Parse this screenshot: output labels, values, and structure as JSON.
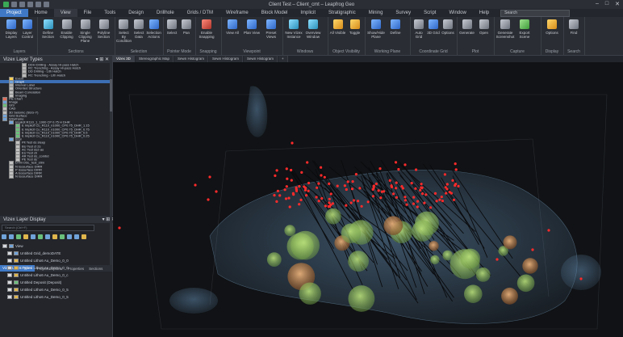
{
  "app": {
    "title": "Client Test – Client_cmt – Leapfrog Geo",
    "window_controls": [
      "–",
      "□",
      "✕"
    ]
  },
  "menu": {
    "tabs": [
      "Project",
      "Home",
      "View",
      "File",
      "Tools",
      "Design",
      "Drillhole",
      "Grids / DTM",
      "Wireframe",
      "Block Model",
      "Implicit",
      "Stratigraphic",
      "Mining",
      "Survey",
      "Script",
      "Window",
      "Help"
    ],
    "active_index": 2,
    "search_placeholder": "Search"
  },
  "ribbon": {
    "groups": [
      {
        "label": "Layers",
        "buttons": [
          {
            "label": "Display Layers",
            "color": "blue"
          },
          {
            "label": "Layer Control",
            "color": "blue"
          }
        ]
      },
      {
        "label": "Sections",
        "buttons": [
          {
            "label": "Define Section",
            "color": "teal"
          },
          {
            "label": "Enable Clipping",
            "color": "gray"
          },
          {
            "label": "Single Clipping Plane",
            "color": "gray"
          },
          {
            "label": "Polyline Section",
            "color": "gray"
          }
        ]
      },
      {
        "label": "Selection",
        "buttons": [
          {
            "label": "Select By Condition",
            "color": "gray"
          },
          {
            "label": "Select Data",
            "color": "gray"
          },
          {
            "label": "Selection Actions",
            "color": "blue"
          }
        ]
      },
      {
        "label": "Pointer Mode",
        "buttons": [
          {
            "label": "Select",
            "color": "gray"
          },
          {
            "label": "Pan",
            "color": "gray"
          }
        ]
      },
      {
        "label": "Snapping",
        "buttons": [
          {
            "label": "Enable Snapping",
            "color": "red"
          }
        ]
      },
      {
        "label": "Viewpoint",
        "buttons": [
          {
            "label": "View All",
            "color": "blue"
          },
          {
            "label": "Plan View",
            "color": "blue"
          },
          {
            "label": "Preset Views",
            "color": "blue"
          }
        ]
      },
      {
        "label": "Windows",
        "buttons": [
          {
            "label": "New Vizex Instance",
            "color": "teal"
          },
          {
            "label": "Overview Window",
            "color": "teal"
          }
        ]
      },
      {
        "label": "Object Visibility",
        "buttons": [
          {
            "label": "All Visible",
            "color": "yellow"
          },
          {
            "label": "Toggle",
            "color": "yellow"
          }
        ]
      },
      {
        "label": "Working Plane",
        "buttons": [
          {
            "label": "Show/Hide Plane",
            "color": "blue"
          },
          {
            "label": "Define",
            "color": "blue"
          }
        ]
      },
      {
        "label": "Coordinate Grid",
        "buttons": [
          {
            "label": "Auto Grid",
            "color": "gray"
          },
          {
            "label": "3D Grid",
            "color": "blue"
          },
          {
            "label": "Options",
            "color": "gray"
          }
        ]
      },
      {
        "label": "Plot",
        "buttons": [
          {
            "label": "Generate",
            "color": "gray"
          },
          {
            "label": "Open",
            "color": "gray"
          }
        ]
      },
      {
        "label": "Capture",
        "buttons": [
          {
            "label": "Generate Screenshot",
            "color": "gray"
          },
          {
            "label": "Export Scene",
            "color": "green"
          }
        ]
      },
      {
        "label": "Display",
        "buttons": [
          {
            "label": "Options",
            "color": "yellow"
          }
        ]
      },
      {
        "label": "Search",
        "buttons": [
          {
            "label": "Find",
            "color": "gray"
          }
        ]
      }
    ]
  },
  "layer_panel": {
    "title": "Vizex Layer Types",
    "rows": [
      {
        "text": "DDH Drilling - Assay Hi-pass Hatch",
        "indent": 3,
        "swatch": "#b8b8b8"
      },
      {
        "text": "RC Trenching - Assay Hi-pass Hatch",
        "indent": 3,
        "swatch": "#b8b8b8"
      },
      {
        "text": "DD Drilling - Lith Hatch",
        "indent": 3,
        "swatch": "#b8b8b8"
      },
      {
        "text": "RC Trenching - Lith Hatch",
        "indent": 3,
        "swatch": "#b8b8b8"
      },
      {
        "text": "Event",
        "indent": 1,
        "swatch": "#ffd154"
      },
      {
        "text": "Graph",
        "indent": 1,
        "swatch": "#70a3d9",
        "selected": true
      },
      {
        "text": "Interval Label",
        "indent": 1,
        "swatch": "#b0b0b0"
      },
      {
        "text": "Oriented Structure",
        "indent": 1,
        "swatch": "#c0c0c0"
      },
      {
        "text": "Beam Correlation",
        "indent": 1,
        "swatch": "#c0c0c0"
      },
      {
        "text": "Imaging",
        "indent": 1,
        "swatch": "#c0c0c0"
      },
      {
        "text": "Pie Chart",
        "indent": 0,
        "swatch": "#e06c5a"
      },
      {
        "text": "Image",
        "indent": 0,
        "swatch": "#70a3d9"
      },
      {
        "text": "GIS",
        "indent": 0,
        "swatch": "#6ac07b"
      },
      {
        "text": "CAD",
        "indent": 0,
        "swatch": "#c0c0c0"
      },
      {
        "text": "3D Seismic (SEG-Y)",
        "indent": 0,
        "swatch": "#c0c0c0"
      },
      {
        "text": "Grid Surface",
        "indent": 0,
        "swatch": "#70a3d9"
      },
      {
        "text": "Wireframe",
        "indent": 0,
        "swatch": "#70a3d9"
      },
      {
        "text": "Implicit R110_1_1000 CP 0.75 H DHR",
        "indent": 1,
        "swatch": "#70a3d9"
      },
      {
        "text": "E Implicit Cu_R110_n1000_CP0.75_DHR_1.15",
        "indent": 2,
        "swatch": "#6ac07b"
      },
      {
        "text": "E Implicit Cu_R110_n1000_CP0.75_DHR_0.75",
        "indent": 2,
        "swatch": "#6ac07b"
      },
      {
        "text": "E Implicit Cu_R110_n1000_CP0.75_DHR_0.5",
        "indent": 2,
        "swatch": "#6ac07b"
      },
      {
        "text": "E Implicit Cu_R110_n1000_CP0.75_DHR_0.25",
        "indent": 2,
        "swatch": "#6ac07b"
      },
      {
        "text": "Impl",
        "indent": 1,
        "swatch": "#70a3d9"
      },
      {
        "text": "Pit Test ds steep",
        "indent": 2,
        "swatch": "#c0c0c0"
      },
      {
        "text": "BU Test ct 2s",
        "indent": 2,
        "swatch": "#c0c0c0"
      },
      {
        "text": "AC Test ds2-ao",
        "indent": 2,
        "swatch": "#c0c0c0"
      },
      {
        "text": "EU Test ch",
        "indent": 2,
        "swatch": "#c0c0c0"
      },
      {
        "text": "AR Test ds_combd",
        "indent": 2,
        "swatch": "#c0c0c0"
      },
      {
        "text": "PE Test ds",
        "indent": 2,
        "swatch": "#c0c0c0"
      },
      {
        "text": "DTM OSL_test_stim",
        "indent": 1,
        "swatch": "#c0c0c0"
      },
      {
        "text": "N Isosurface DIRR",
        "indent": 1,
        "swatch": "#c0c0c0"
      },
      {
        "text": "P Isosurface DIRR",
        "indent": 1,
        "swatch": "#c0c0c0"
      },
      {
        "text": "A Isosurface DIRR",
        "indent": 1,
        "swatch": "#c0c0c0"
      },
      {
        "text": "N Isosurface DIRR",
        "indent": 1,
        "swatch": "#c0c0c0"
      }
    ]
  },
  "bottom_tabs": [
    "Vizex Layer Types",
    "Project Explorer",
    "Properties",
    "Sections"
  ],
  "display_panel": {
    "title": "Vizex Layer Display",
    "search_placeholder": "Search (Ctrl+F)",
    "rows": [
      {
        "text": "View",
        "indent": 0,
        "swatch": "#70a3d9"
      },
      {
        "text": "Untitled Grid_demoDATE",
        "indent": 1,
        "swatch": "#70a3d9"
      },
      {
        "text": "Untitled Litho6 Au_Demo_0_0",
        "indent": 1,
        "swatch": "#e0b64c"
      },
      {
        "text": "Untitled Litho6 Au_Demo_0_0",
        "indent": 1,
        "swatch": "#e0b64c"
      },
      {
        "text": "Untitled Litho6 Au_Demo_0_c",
        "indent": 1,
        "swatch": "#e0b64c"
      },
      {
        "text": "Untitled Deposit (Deposit)",
        "indent": 1,
        "swatch": "#6ac07b"
      },
      {
        "text": "Untitled Litho6 Au_Demo_0_5",
        "indent": 1,
        "swatch": "#e0b64c"
      },
      {
        "text": "Untitled Litho6 Au_Demo_0_5",
        "indent": 1,
        "swatch": "#e0b64c"
      }
    ]
  },
  "viewport": {
    "tabs": [
      "Vizex 3D",
      "Stereographic Map",
      "Sewn Histogram",
      "Sewn Histogram",
      "Sewn Histogram",
      "+"
    ],
    "active_index": 0,
    "colors": {
      "background": "#101215",
      "shell": "#5f86a8",
      "ore": "#6d9a43",
      "sample": "#ff2b2b",
      "drill": "#0a0b0d"
    }
  }
}
